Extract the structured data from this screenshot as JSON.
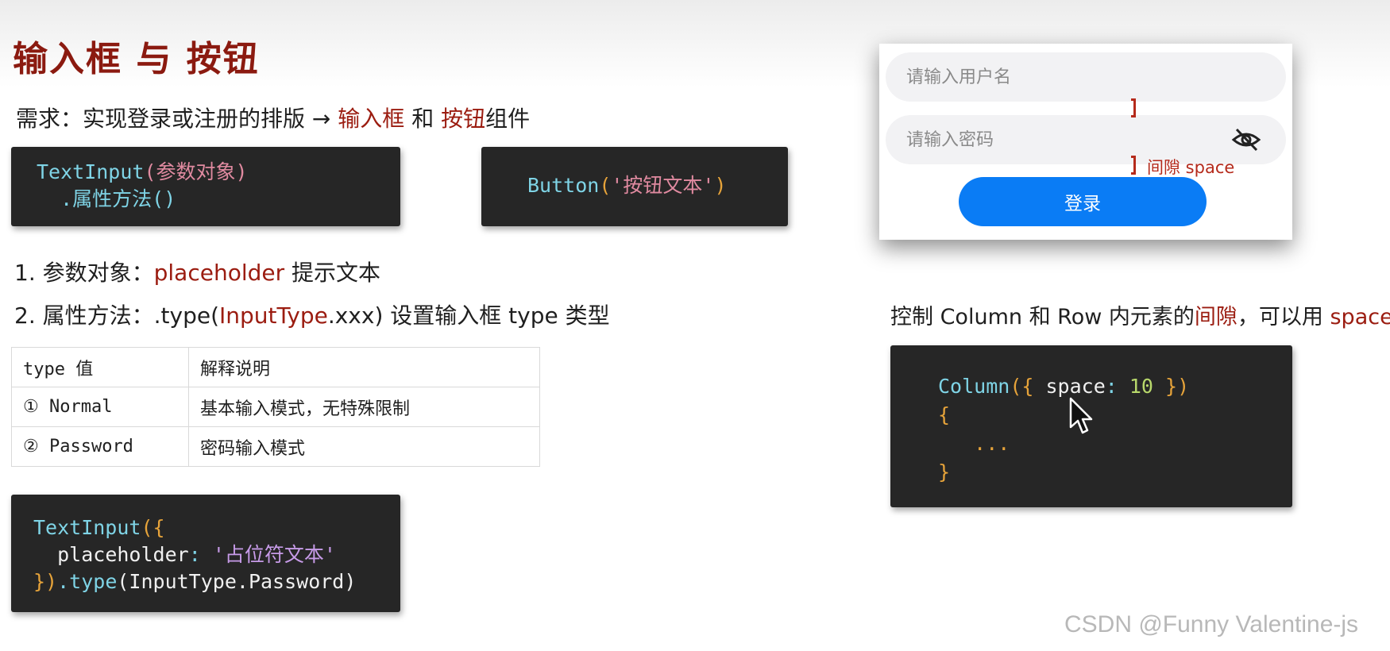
{
  "title": "输入框 与 按钮",
  "requirement": {
    "prefix": "需求：实现登录或注册的排版 →",
    "input_word": "输入框",
    "and": "和",
    "button_word": "按钮",
    "suffix": "组件"
  },
  "code_textinput": {
    "fn": "TextInput",
    "param": "(参数对象)",
    "method": ".属性方法()"
  },
  "code_button": {
    "fn": "Button",
    "open": "(",
    "arg": "'按钮文本'",
    "close": ")"
  },
  "list": {
    "item1_prefix": "1. 参数对象：",
    "item1_key": "placeholder",
    "item1_suffix": "提示文本",
    "item2_prefix": "2. 属性方法：.type(",
    "item2_key": "InputType",
    "item2_mid": ".xxx)",
    "item2_suffix": "设置输入框 type 类型"
  },
  "type_table": {
    "headers": [
      "type 值",
      "解释说明"
    ],
    "rows": [
      [
        "① Normal",
        "基本输入模式，无特殊限制"
      ],
      [
        "② Password",
        "密码输入模式"
      ]
    ]
  },
  "code_example": {
    "line1_fn": "TextInput",
    "line1_brace": "({",
    "line2_key": "placeholder",
    "line2_colon": ":",
    "line2_val": "'占位符文本'",
    "line3_brace": "})",
    "line3_method": ".type",
    "line3_arg": "(InputType.Password)"
  },
  "login_demo": {
    "username_placeholder": "请输入用户名",
    "password_placeholder": "请输入密码",
    "login_label": "登录",
    "gap_label": "间隙 space"
  },
  "spacing_note": {
    "prefix": "控制 Column 和 Row 内元素的",
    "gap_word": "间隙",
    "suffix": "，可以用",
    "space_word": "space"
  },
  "code_column": {
    "fn": "Column",
    "open": "({",
    "key": "space",
    "colon": ":",
    "val": "10",
    "close": "})",
    "brace_open": "{",
    "dots": "...",
    "brace_close": "}"
  },
  "watermark": "CSDN @Funny Valentine-js",
  "colors": {
    "title_red": "#8b1a10",
    "keyword_red": "#9b1c10",
    "code_bg": "#262626",
    "login_blue": "#0a7cf5"
  },
  "icons": [
    "eye-off-icon",
    "mouse-cursor-icon"
  ]
}
